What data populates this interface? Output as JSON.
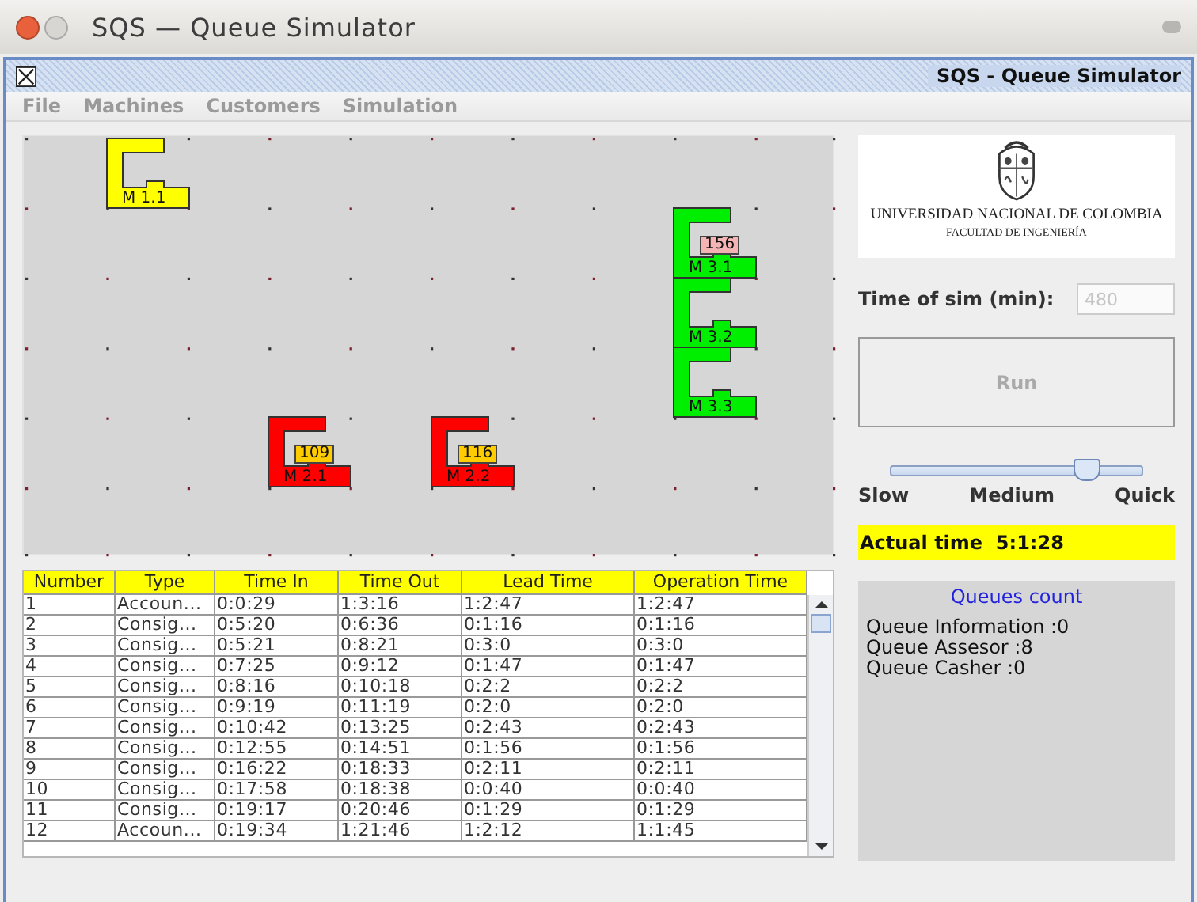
{
  "window": {
    "title": "SQS — Queue Simulator"
  },
  "frame": {
    "title": "SQS - Queue Simulator"
  },
  "menu": [
    {
      "label": "File"
    },
    {
      "label": "Machines"
    },
    {
      "label": "Customers"
    },
    {
      "label": "Simulation"
    }
  ],
  "machines": [
    {
      "label": "M 1.1",
      "color": "#ffff00"
    },
    {
      "label": "M 3.1",
      "color": "#00ee00",
      "badge": {
        "text": "156",
        "color": "#f4b4b4"
      }
    },
    {
      "label": "M 3.2",
      "color": "#00ee00"
    },
    {
      "label": "M 3.3",
      "color": "#00ee00"
    },
    {
      "label": "M 2.1",
      "color": "#ff0000",
      "badge": {
        "text": "109",
        "color": "#ffcc00"
      }
    },
    {
      "label": "M 2.2",
      "color": "#ff0000",
      "badge": {
        "text": "116",
        "color": "#ffcc00"
      }
    }
  ],
  "logo": {
    "line_1": "UNIVERSIDAD NACIONAL DE COLOMBIA",
    "line_2": "FACULTAD DE INGENIERÍA"
  },
  "sim_time": {
    "label": "Time of sim (min):",
    "value": "480",
    "disabled": true
  },
  "run_button": {
    "label": "Run",
    "disabled": true
  },
  "speed": {
    "level": 0.78,
    "labels": [
      "Slow",
      "Medium",
      "Quick"
    ]
  },
  "actual_time": "Actual time  5:1:28",
  "table": {
    "columns": [
      "Number",
      "Type",
      "Time In",
      "Time Out",
      "Lead Time",
      "Operation Time"
    ],
    "rows": [
      [
        "1",
        "Accoun...",
        "0:0:29",
        "1:3:16",
        "1:2:47",
        "1:2:47"
      ],
      [
        "2",
        "Consig...",
        "0:5:20",
        "0:6:36",
        "0:1:16",
        "0:1:16"
      ],
      [
        "3",
        "Consig...",
        "0:5:21",
        "0:8:21",
        "0:3:0",
        "0:3:0"
      ],
      [
        "4",
        "Consig...",
        "0:7:25",
        "0:9:12",
        "0:1:47",
        "0:1:47"
      ],
      [
        "5",
        "Consig...",
        "0:8:16",
        "0:10:18",
        "0:2:2",
        "0:2:2"
      ],
      [
        "6",
        "Consig...",
        "0:9:19",
        "0:11:19",
        "0:2:0",
        "0:2:0"
      ],
      [
        "7",
        "Consig...",
        "0:10:42",
        "0:13:25",
        "0:2:43",
        "0:2:43"
      ],
      [
        "8",
        "Consig...",
        "0:12:55",
        "0:14:51",
        "0:1:56",
        "0:1:56"
      ],
      [
        "9",
        "Consig...",
        "0:16:22",
        "0:18:33",
        "0:2:11",
        "0:2:11"
      ],
      [
        "10",
        "Consig...",
        "0:17:58",
        "0:18:38",
        "0:0:40",
        "0:0:40"
      ],
      [
        "11",
        "Consig...",
        "0:19:17",
        "0:20:46",
        "0:1:29",
        "0:1:29"
      ],
      [
        "12",
        "Accoun...",
        "0:19:34",
        "1:21:46",
        "1:2:12",
        "1:1:45"
      ]
    ]
  },
  "queues": {
    "title": "Queues count",
    "lines": [
      "Queue Information :0",
      "Queue Assesor :8",
      "Queue Casher :0"
    ]
  }
}
